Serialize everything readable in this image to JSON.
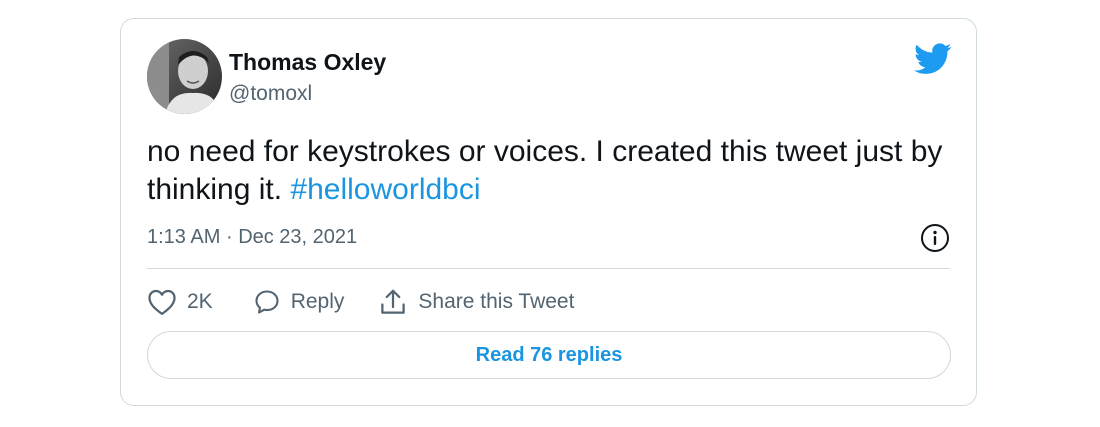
{
  "tweet": {
    "author": {
      "name": "Thomas Oxley",
      "handle": "@tomoxl"
    },
    "text_part1": "no need for keystrokes or voices. I created this tweet just by thinking it.",
    "hashtag": "#helloworldbci",
    "time": "1:13 AM",
    "separator": "·",
    "date": "Dec 23, 2021"
  },
  "actions": {
    "like_count": "2K",
    "reply_label": "Reply",
    "share_label": "Share this Tweet"
  },
  "footer": {
    "read_replies_label": "Read 76 replies"
  },
  "icons": {
    "brand": "twitter-bird-icon",
    "info": "info-icon",
    "like": "heart-icon",
    "reply": "speech-bubble-icon",
    "share": "share-upload-icon"
  },
  "colors": {
    "brand_blue": "#1d9bf0",
    "link_blue": "#1b95e0",
    "text_primary": "#0f1419",
    "text_secondary": "#536471",
    "border": "#cfd9de"
  }
}
